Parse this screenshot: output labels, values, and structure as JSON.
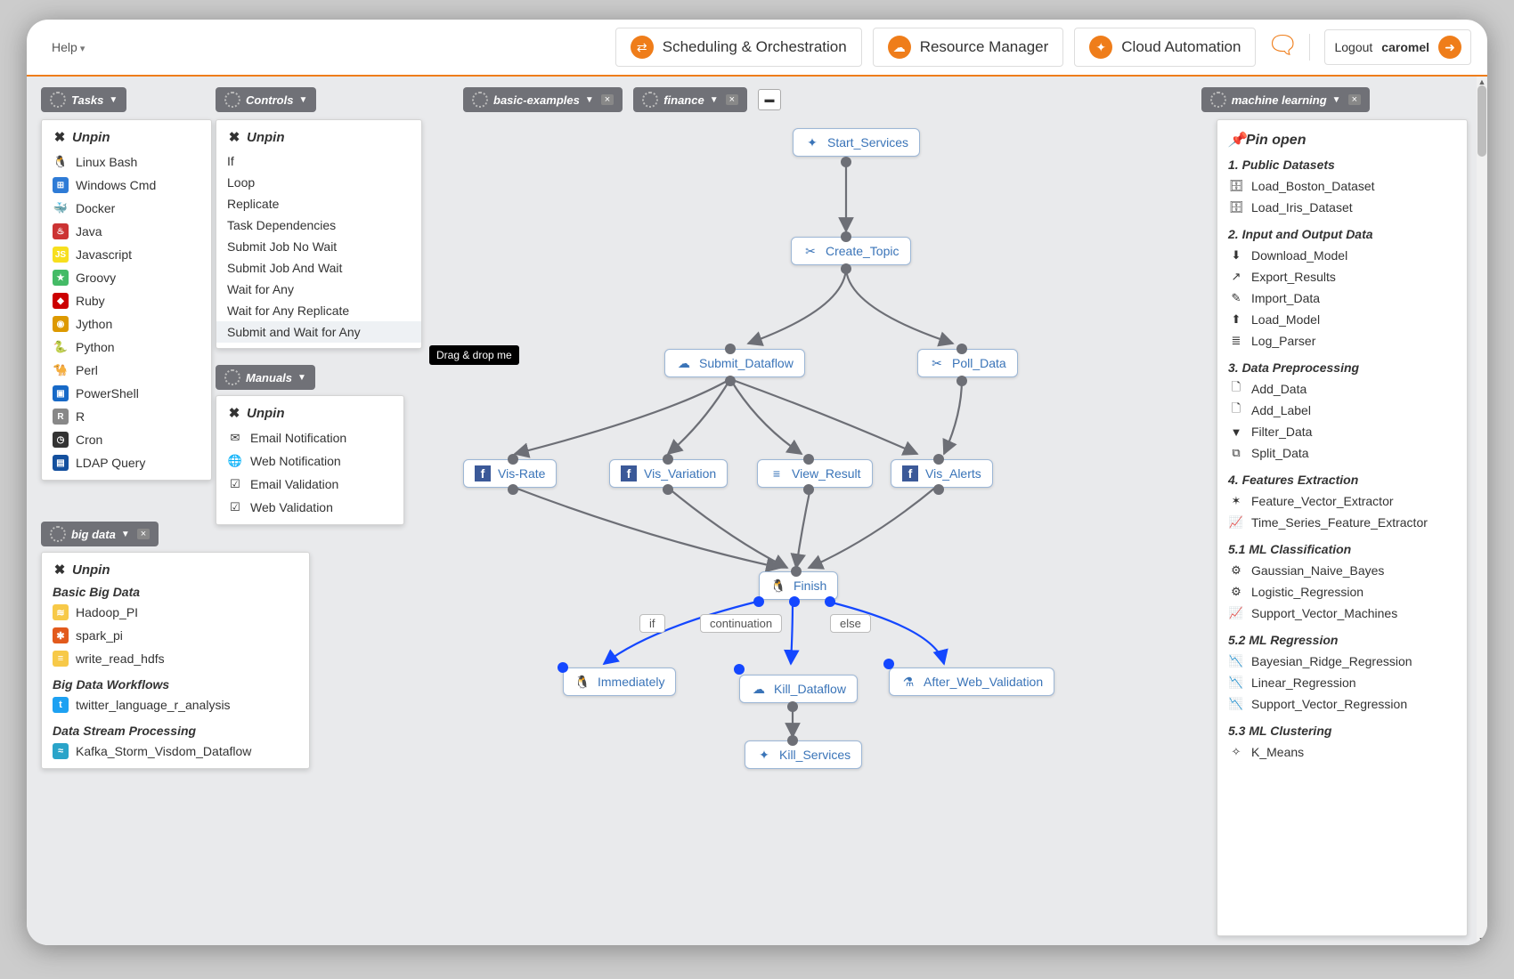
{
  "header": {
    "help": "Help",
    "buttons": [
      {
        "label": "Scheduling & Orchestration",
        "icon": "⇄"
      },
      {
        "label": "Resource Manager",
        "icon": "☁"
      },
      {
        "label": "Cloud Automation",
        "icon": "✦"
      }
    ],
    "logout_prefix": "Logout ",
    "logout_user": "caromel"
  },
  "tabs": {
    "t1": "basic-examples",
    "t2": "finance"
  },
  "tooltip": "Drag & drop me",
  "drops": {
    "tasks": {
      "title": "Tasks",
      "pin": "Unpin",
      "items": [
        {
          "label": "Linux Bash",
          "icon": "🐧",
          "c": ""
        },
        {
          "label": "Windows Cmd",
          "icon": "⊞",
          "c": "#2e7bd6"
        },
        {
          "label": "Docker",
          "icon": "🐳",
          "c": ""
        },
        {
          "label": "Java",
          "icon": "♨",
          "c": "#c33"
        },
        {
          "label": "Javascript",
          "icon": "JS",
          "c": "#f7df1e"
        },
        {
          "label": "Groovy",
          "icon": "★",
          "c": "#4b6"
        },
        {
          "label": "Ruby",
          "icon": "◆",
          "c": "#c00"
        },
        {
          "label": "Jython",
          "icon": "◉",
          "c": "#d90"
        },
        {
          "label": "Python",
          "icon": "🐍",
          "c": ""
        },
        {
          "label": "Perl",
          "icon": "🐪",
          "c": ""
        },
        {
          "label": "PowerShell",
          "icon": "▣",
          "c": "#1769c7"
        },
        {
          "label": "R",
          "icon": "R",
          "c": "#888"
        },
        {
          "label": "Cron",
          "icon": "◷",
          "c": "#333"
        },
        {
          "label": "LDAP Query",
          "icon": "▤",
          "c": "#14509e"
        }
      ]
    },
    "controls": {
      "title": "Controls",
      "pin": "Unpin",
      "items": [
        "If",
        "Loop",
        "Replicate",
        "Task Dependencies",
        "Submit Job No Wait",
        "Submit Job And Wait",
        "Wait for Any",
        "Wait for Any Replicate",
        "Submit and Wait for Any"
      ]
    },
    "manuals": {
      "title": "Manuals",
      "pin": "Unpin",
      "items": [
        {
          "label": "Email Notification",
          "icon": "✉"
        },
        {
          "label": "Web Notification",
          "icon": "🌐"
        },
        {
          "label": "Email Validation",
          "icon": "☑"
        },
        {
          "label": "Web Validation",
          "icon": "☑"
        }
      ]
    },
    "bigdata": {
      "title": "big data",
      "pin": "Unpin",
      "sections": [
        {
          "h": "Basic Big Data",
          "items": [
            {
              "label": "Hadoop_PI",
              "icon": "≋",
              "c": "#f7c948"
            },
            {
              "label": "spark_pi",
              "icon": "✱",
              "c": "#e25a1c"
            },
            {
              "label": "write_read_hdfs",
              "icon": "≡",
              "c": "#f7c948"
            }
          ]
        },
        {
          "h": "Big Data Workflows",
          "items": [
            {
              "label": "twitter_language_r_analysis",
              "icon": "t",
              "c": "#1da1f2"
            }
          ]
        },
        {
          "h": "Data Stream Processing",
          "items": [
            {
              "label": "Kafka_Storm_Visdom_Dataflow",
              "icon": "≈",
              "c": "#2aa4c9"
            }
          ]
        }
      ]
    },
    "ml": {
      "title": "machine learning",
      "pin": "Pin open",
      "sections": [
        {
          "h": "1. Public Datasets",
          "items": [
            {
              "label": "Load_Boston_Dataset",
              "icon": "🗄"
            },
            {
              "label": "Load_Iris_Dataset",
              "icon": "🗄"
            }
          ]
        },
        {
          "h": "2. Input and Output Data",
          "items": [
            {
              "label": "Download_Model",
              "icon": "⬇"
            },
            {
              "label": "Export_Results",
              "icon": "↗"
            },
            {
              "label": "Import_Data",
              "icon": "✎"
            },
            {
              "label": "Load_Model",
              "icon": "⬆"
            },
            {
              "label": "Log_Parser",
              "icon": "≣"
            }
          ]
        },
        {
          "h": "3. Data Preprocessing",
          "items": [
            {
              "label": "Add_Data",
              "icon": "🗋"
            },
            {
              "label": "Add_Label",
              "icon": "🗋"
            },
            {
              "label": "Filter_Data",
              "icon": "▼"
            },
            {
              "label": "Split_Data",
              "icon": "⧉"
            }
          ]
        },
        {
          "h": "4. Features Extraction",
          "items": [
            {
              "label": "Feature_Vector_Extractor",
              "icon": "✶"
            },
            {
              "label": "Time_Series_Feature_Extractor",
              "icon": "📈"
            }
          ]
        },
        {
          "h": "5.1 ML Classification",
          "items": [
            {
              "label": "Gaussian_Naive_Bayes",
              "icon": "⚙"
            },
            {
              "label": "Logistic_Regression",
              "icon": "⚙"
            },
            {
              "label": "Support_Vector_Machines",
              "icon": "📈"
            }
          ]
        },
        {
          "h": "5.2 ML Regression",
          "items": [
            {
              "label": "Bayesian_Ridge_Regression",
              "icon": "📉"
            },
            {
              "label": "Linear_Regression",
              "icon": "📉"
            },
            {
              "label": "Support_Vector_Regression",
              "icon": "📉"
            }
          ]
        },
        {
          "h": "5.3 ML Clustering",
          "items": [
            {
              "label": "K_Means",
              "icon": "✧"
            }
          ]
        }
      ]
    }
  },
  "branches": {
    "if": "if",
    "cont": "continuation",
    "else": "else"
  },
  "nodes": {
    "start": {
      "label": "Start_Services",
      "icon": "✦"
    },
    "topic": {
      "label": "Create_Topic",
      "icon": "✂"
    },
    "submit": {
      "label": "Submit_Dataflow",
      "icon": "☁"
    },
    "poll": {
      "label": "Poll_Data",
      "icon": "✂"
    },
    "visrate": {
      "label": "Vis-Rate",
      "icon": "f"
    },
    "visvar": {
      "label": "Vis_Variation",
      "icon": "f"
    },
    "view": {
      "label": "View_Result",
      "icon": "≡"
    },
    "visalerts": {
      "label": "Vis_Alerts",
      "icon": "f"
    },
    "finish": {
      "label": "Finish",
      "icon": "🐧"
    },
    "imm": {
      "label": "Immediately",
      "icon": "🐧"
    },
    "kill": {
      "label": "Kill_Dataflow",
      "icon": "☁"
    },
    "after": {
      "label": "After_Web_Validation",
      "icon": "⚗"
    },
    "kills": {
      "label": "Kill_Services",
      "icon": "✦"
    }
  }
}
